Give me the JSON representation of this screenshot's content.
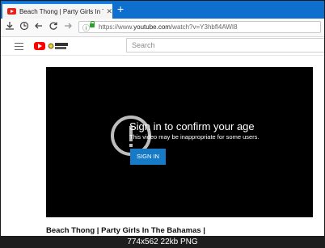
{
  "browser": {
    "tab_title": "Beach Thong | Party Girls In Th",
    "tab_close": "✕",
    "new_tab": "+",
    "url_prefix": "https://www.",
    "url_domain": "youtube.com",
    "url_path": "/watch?v=Y3hbfl4AWI8"
  },
  "youtube": {
    "search_placeholder": "Search"
  },
  "player": {
    "title": "Sign in to confirm your age",
    "subtitle": "This video may be inappropriate for some users.",
    "signin_label": "SIGN IN"
  },
  "video": {
    "title": "Beach Thong | Party Girls In The Bahamas |"
  },
  "caption": "774x562 22kb PNG",
  "colors": {
    "tab_strip": "#0f6fcf",
    "yt_red": "#ff0000",
    "signin_blue": "#167ac6"
  },
  "icons": [
    "youtube-favicon-icon",
    "download-icon",
    "history-icon",
    "back-icon",
    "forward-icon",
    "reload-icon",
    "info-icon",
    "lock-icon",
    "hamburger-icon",
    "youtube-logo-icon",
    "warning-icon"
  ]
}
